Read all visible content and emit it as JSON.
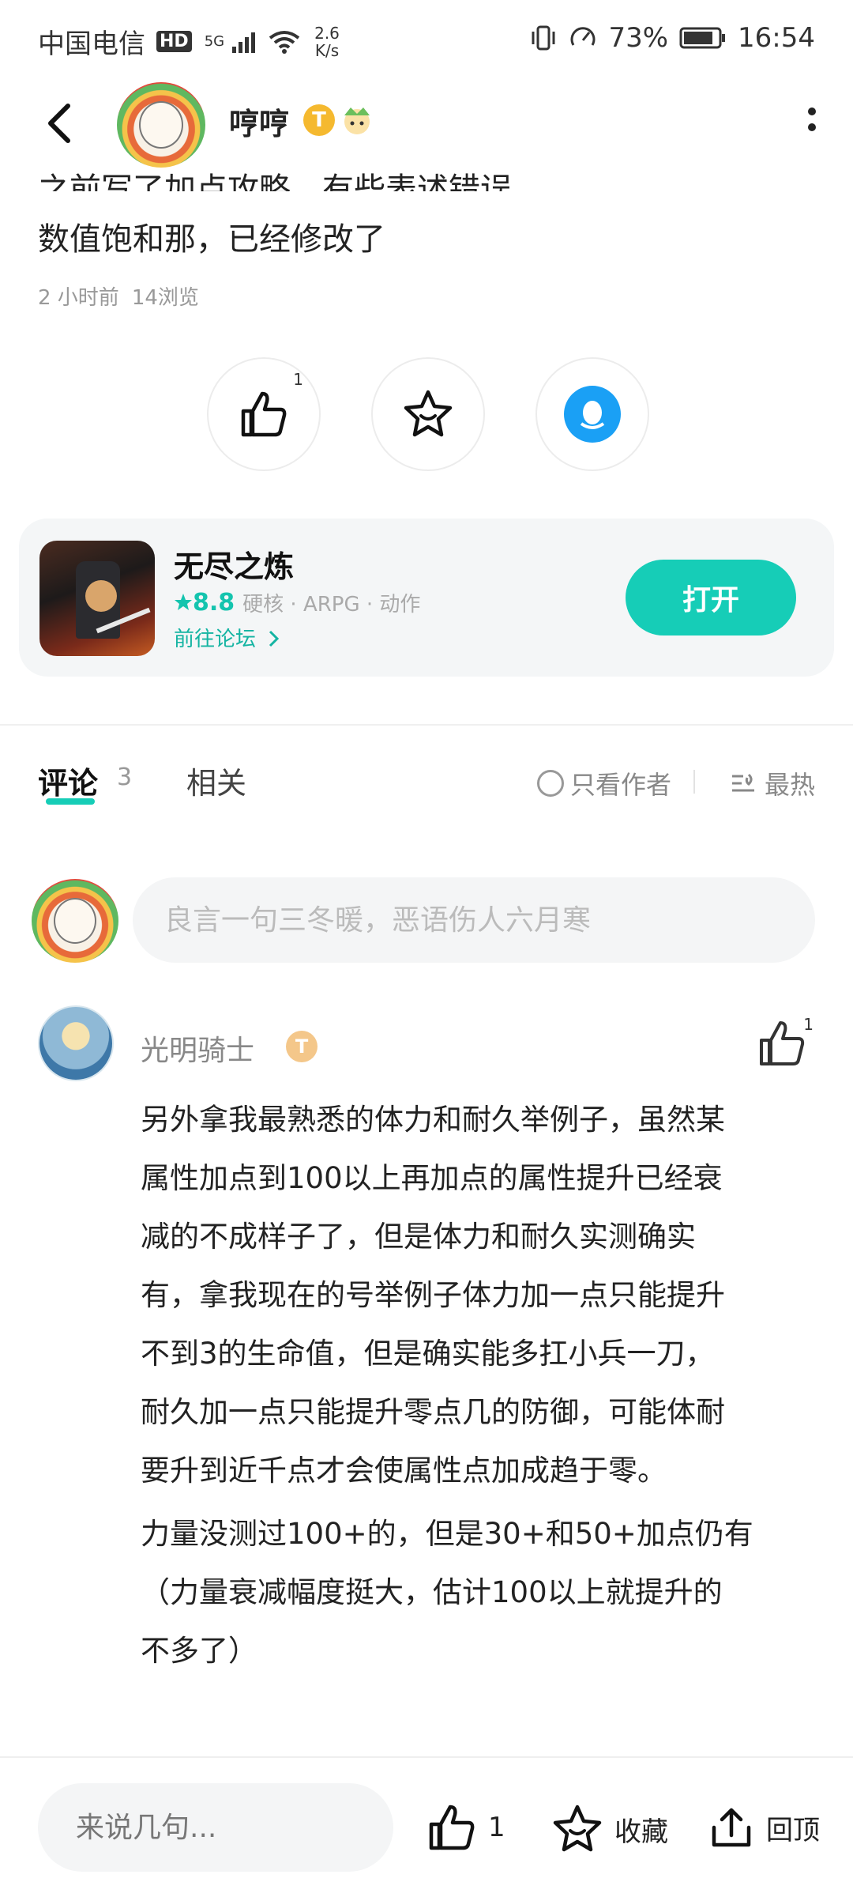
{
  "status_bar": {
    "carrier": "中国电信",
    "hd": "HD",
    "network": "5G",
    "speed_value": "2.6",
    "speed_unit": "K/s",
    "battery_percent": "73%",
    "time": "16:54"
  },
  "header": {
    "author_name": "哼哼",
    "badge_letter": "T"
  },
  "post": {
    "clipped_line": "之前写了加点攻略，有些表述错误",
    "body_line": "数值饱和那，已经修改了",
    "time_ago": "2 小时前",
    "views": "14浏览",
    "like_count": "1"
  },
  "game_card": {
    "title": "无尽之炼",
    "score": "8.8",
    "tags": "硬核 · ARPG · 动作",
    "forum_link": "前往论坛",
    "open_label": "打开"
  },
  "tabs": {
    "comments_label": "评论",
    "comments_count": "3",
    "related_label": "相关",
    "only_author": "只看作者",
    "sort_hot": "最热"
  },
  "comment_input": {
    "placeholder": "良言一句三冬暖，恶语伤人六月寒"
  },
  "comment": {
    "user_name": "光明骑士",
    "badge_letter": "T",
    "like_count": "1",
    "paragraph_1": "另外拿我最熟悉的体力和耐久举例子，虽然某\n属性加点到100以上再加点的属性提升已经衰\n减的不成样子了，但是体力和耐久实测确实\n有，拿我现在的号举例子体力加一点只能提升\n不到3的生命值，但是确实能多扛小兵一刀，\n耐久加一点只能提升零点几的防御，可能体耐\n要升到近千点才会使属性点加成趋于零。",
    "paragraph_2": "力量没测过100+的，但是30+和50+加点仍有\n（力量衰减幅度挺大，估计100以上就提升的\n不多了）"
  },
  "bottom_bar": {
    "reply_placeholder": "来说几句...",
    "like_count": "1",
    "favorite_label": "收藏",
    "top_label": "回顶"
  },
  "colors": {
    "accent": "#16cdb7",
    "qq_blue": "#1aa0f5",
    "badge_gold": "#f5b92f"
  }
}
